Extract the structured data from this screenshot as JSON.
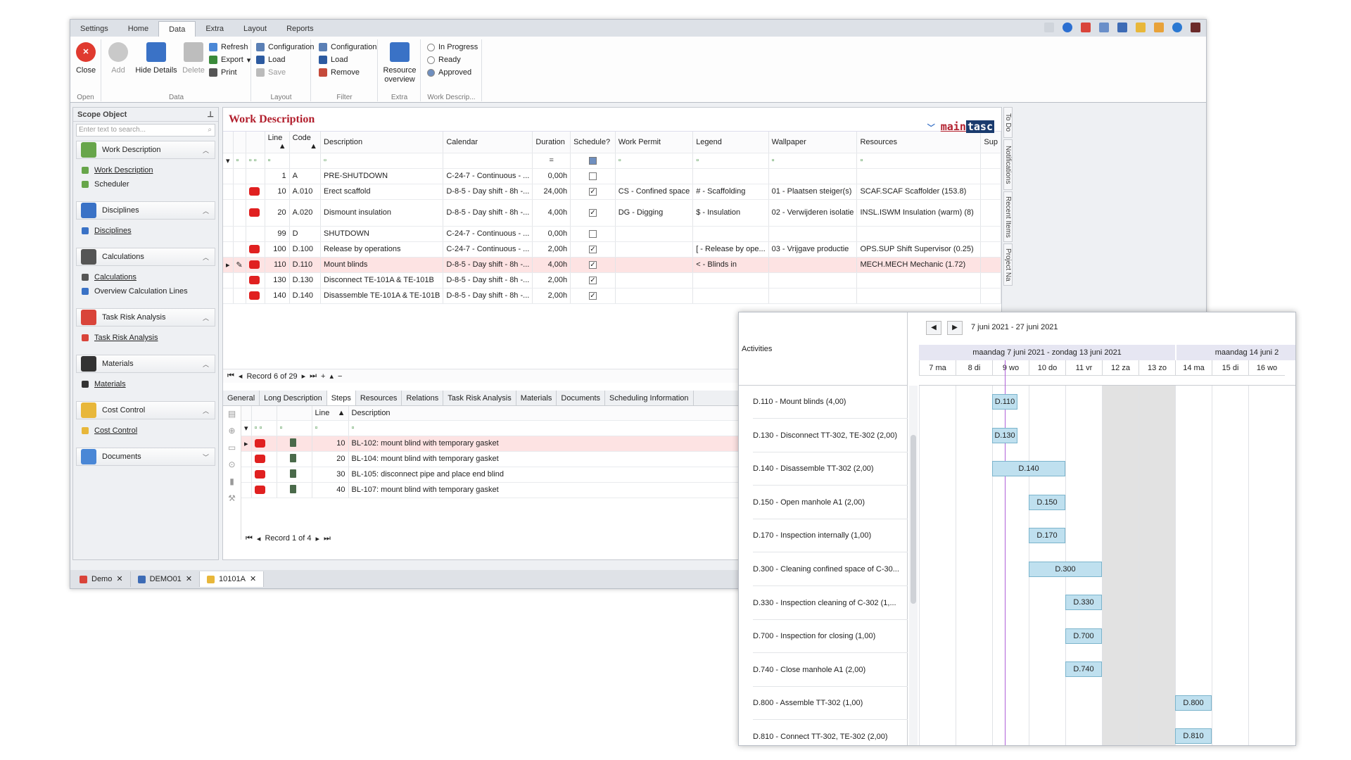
{
  "ribbon_tabs": [
    "Settings",
    "Home",
    "Data",
    "Extra",
    "Layout",
    "Reports"
  ],
  "ribbon": {
    "open": {
      "close": "Close",
      "label": "Open"
    },
    "data": {
      "add": "Add",
      "hide_details": "Hide Details",
      "delete": "Delete",
      "refresh": "Refresh",
      "export": "Export",
      "print": "Print",
      "label": "Data"
    },
    "layout": {
      "configuration": "Configuration",
      "load": "Load",
      "save": "Save",
      "label": "Layout"
    },
    "filter": {
      "configuration": "Configuration",
      "load": "Load",
      "remove": "Remove",
      "label": "Filter"
    },
    "extra": {
      "resource_overview": "Resource overview",
      "label": "Extra"
    },
    "workdesc": {
      "in_progress": "In Progress",
      "ready": "Ready",
      "approved": "Approved",
      "label": "Work Descrip..."
    }
  },
  "scope": {
    "title": "Scope Object",
    "search_placeholder": "Enter text to search...",
    "sections": [
      {
        "label": "Work Description",
        "items": [
          "Work Description",
          "Scheduler"
        ]
      },
      {
        "label": "Disciplines",
        "items": [
          "Disciplines"
        ]
      },
      {
        "label": "Calculations",
        "items": [
          "Calculations",
          "Overview Calculation Lines"
        ]
      },
      {
        "label": "Task Risk Analysis",
        "items": [
          "Task Risk Analysis"
        ]
      },
      {
        "label": "Materials",
        "items": [
          "Materials"
        ]
      },
      {
        "label": "Cost Control",
        "items": [
          "Cost Control"
        ]
      },
      {
        "label": "Documents",
        "items": []
      }
    ]
  },
  "main": {
    "title": "Work Description",
    "logo_a": "main",
    "logo_b": "tasc",
    "columns": [
      "Line",
      "Code",
      "Description",
      "Calendar",
      "Duration",
      "Schedule?",
      "Work Permit",
      "Legend",
      "Wallpaper",
      "Resources",
      "Sup"
    ],
    "rows": [
      {
        "line": "1",
        "code": "A",
        "desc": "PRE-SHUTDOWN",
        "cal": "C-24-7 - Continuous - ...",
        "dur": "0,00h",
        "sch": false,
        "permit": "",
        "legend": "",
        "wall": "",
        "res": "",
        "badge": false
      },
      {
        "line": "10",
        "code": "A.010",
        "desc": "Erect scaffold",
        "cal": "D-8-5 - Day shift - 8h -...",
        "dur": "24,00h",
        "sch": true,
        "permit": "CS - Confined space",
        "legend": "# - Scaffolding",
        "wall": "01 - Plaatsen steiger(s)",
        "res": "SCAF.SCAF Scaffolder (153.8)",
        "badge": true
      },
      {
        "line": "20",
        "code": "A.020",
        "desc": "Dismount insulation",
        "cal": "D-8-5 - Day shift - 8h -...",
        "dur": "4,00h",
        "sch": true,
        "permit": "DG - Digging",
        "legend": "$ - Insulation",
        "wall": "02 - Verwijderen isolatie",
        "res": "INSL.ISWM Insulation (warm) (8)",
        "badge": true
      },
      {
        "line": "99",
        "code": "D",
        "desc": "SHUTDOWN",
        "cal": "C-24-7 - Continuous - ...",
        "dur": "0,00h",
        "sch": false,
        "permit": "",
        "legend": "",
        "wall": "",
        "res": "",
        "badge": false
      },
      {
        "line": "100",
        "code": "D.100",
        "desc": "Release by operations",
        "cal": "C-24-7 - Continuous - ...",
        "dur": "2,00h",
        "sch": true,
        "permit": "",
        "legend": "[ - Release by ope...",
        "wall": "03 - Vrijgave productie",
        "res": "OPS.SUP Shift Supervisor (0.25)",
        "badge": true
      },
      {
        "line": "110",
        "code": "D.110",
        "desc": "Mount blinds",
        "cal": "D-8-5 - Day shift - 8h -...",
        "dur": "4,00h",
        "sch": true,
        "permit": "",
        "legend": "< - Blinds in",
        "wall": "",
        "res": "MECH.MECH Mechanic (1.72)",
        "badge": true
      },
      {
        "line": "130",
        "code": "D.130",
        "desc": "Disconnect TE-101A & TE-101B",
        "cal": "D-8-5 - Day shift - 8h -...",
        "dur": "2,00h",
        "sch": true,
        "permit": "",
        "legend": "",
        "wall": "",
        "res": "",
        "badge": true
      },
      {
        "line": "140",
        "code": "D.140",
        "desc": "Disassemble TE-101A & TE-101B",
        "cal": "D-8-5 - Day shift - 8h -...",
        "dur": "2,00h",
        "sch": true,
        "permit": "",
        "legend": "",
        "wall": "",
        "res": "",
        "badge": true
      }
    ],
    "record": "Record 6 of 29"
  },
  "subtabs": [
    "General",
    "Long Description",
    "Steps",
    "Resources",
    "Relations",
    "Task Risk Analysis",
    "Materials",
    "Documents",
    "Scheduling Information"
  ],
  "steps": {
    "columns": [
      "Line",
      "Description"
    ],
    "rows": [
      {
        "line": "10",
        "desc": "BL-102: mount blind with temporary gasket"
      },
      {
        "line": "20",
        "desc": "BL-104: mount blind with temporary gasket"
      },
      {
        "line": "30",
        "desc": "BL-105: disconnect pipe and place end blind"
      },
      {
        "line": "40",
        "desc": "BL-107: mount blind with temporary gasket"
      }
    ],
    "record": "Record 1 of 4"
  },
  "side_tabs": [
    "To Do",
    "Notifications",
    "Recent Items",
    "Project Na"
  ],
  "doc_tabs": [
    "Demo",
    "DEMO01",
    "10101A"
  ],
  "gantt": {
    "activities_label": "Activities",
    "range": "7 juni 2021 - 27 juni 2021",
    "week1": "maandag 7 juni 2021 - zondag 13 juni 2021",
    "week2": "maandag 14 juni 2",
    "days": [
      "7 ma",
      "8 di",
      "9 wo",
      "10 do",
      "11 vr",
      "12 za",
      "13 zo",
      "14 ma",
      "15 di",
      "16 wo"
    ],
    "activities": [
      "D.110 - Mount blinds (4,00)",
      "D.130 - Disconnect TT-302, TE-302 (2,00)",
      "D.140 - Disassemble TT-302 (2,00)",
      "D.150 - Open manhole A1 (2,00)",
      "D.170 - Inspection internally (1,00)",
      "D.300 - Cleaning confined space of C-30...",
      "D.330 - Inspection cleaning of C-302 (1,...",
      "D.700 - Inspection for closing (1,00)",
      "D.740 - Close manhole A1 (2,00)",
      "D.800 - Assemble TT-302 (1,00)",
      "D.810 - Connect TT-302, TE-302 (2,00)"
    ],
    "bars": [
      "D.110",
      "D.130",
      "D.140",
      "D.150",
      "D.170",
      "D.300",
      "D.330",
      "D.700",
      "D.740",
      "D.800",
      "D.810"
    ]
  }
}
